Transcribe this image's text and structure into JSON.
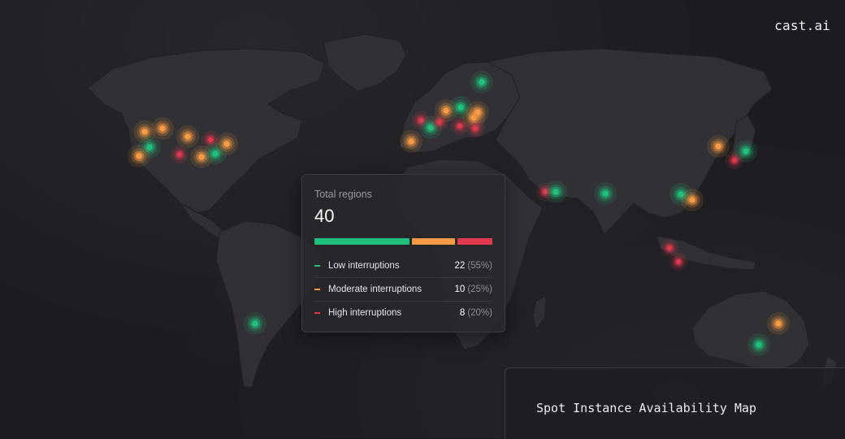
{
  "brand": {
    "logo_text": "cast.ai"
  },
  "summary": {
    "label": "Total regions",
    "total": "40",
    "bar": [
      {
        "key": "low",
        "fraction": 0.55,
        "color": "#1fbf7d"
      },
      {
        "key": "moderate",
        "fraction": 0.25,
        "color": "#f79a45"
      },
      {
        "key": "high",
        "fraction": 0.2,
        "color": "#e0384f"
      }
    ],
    "rows": [
      {
        "name": "Low interruptions",
        "count": "22",
        "percent": "(55%)",
        "color": "#1fbf7d"
      },
      {
        "name": "Moderate interruptions",
        "count": "10",
        "percent": "(25%)",
        "color": "#f79a45"
      },
      {
        "name": "High interruptions",
        "count": "8",
        "percent": "(20%)",
        "color": "#e0384f"
      }
    ]
  },
  "caption": {
    "title": "Spot Instance Availability Map"
  },
  "colors": {
    "low": "#1fbf7d",
    "moderate": "#f79a45",
    "high": "#e0384f",
    "land": "#313134",
    "background": "#1c1c1e"
  },
  "map": {
    "region_markers": [
      {
        "region": "us-west-1",
        "level": "moderate"
      },
      {
        "region": "us-west-2",
        "level": "moderate"
      },
      {
        "region": "us-west-3",
        "level": "low"
      },
      {
        "region": "us-west-4",
        "level": "moderate"
      },
      {
        "region": "us-central-1",
        "level": "moderate"
      },
      {
        "region": "us-central-2",
        "level": "high"
      },
      {
        "region": "us-central-3",
        "level": "moderate"
      },
      {
        "region": "us-east-1",
        "level": "high"
      },
      {
        "region": "us-east-2",
        "level": "low"
      },
      {
        "region": "us-east-3",
        "level": "moderate"
      },
      {
        "region": "sa-east-1",
        "level": "low"
      },
      {
        "region": "eu-north-1",
        "level": "low"
      },
      {
        "region": "eu-west-1",
        "level": "moderate"
      },
      {
        "region": "eu-west-2",
        "level": "high"
      },
      {
        "region": "eu-west-3",
        "level": "low"
      },
      {
        "region": "eu-central-1",
        "level": "high"
      },
      {
        "region": "eu-central-2",
        "level": "moderate"
      },
      {
        "region": "eu-central-3",
        "level": "low"
      },
      {
        "region": "eu-central-4",
        "level": "high"
      },
      {
        "region": "eu-south-1",
        "level": "moderate"
      },
      {
        "region": "eu-south-2",
        "level": "high"
      },
      {
        "region": "eu-south-3",
        "level": "moderate"
      },
      {
        "region": "me-south-1",
        "level": "high"
      },
      {
        "region": "me-central-1",
        "level": "low"
      },
      {
        "region": "ap-south-1",
        "level": "low"
      },
      {
        "region": "ap-southeast-1",
        "level": "low"
      },
      {
        "region": "ap-east-1",
        "level": "moderate"
      },
      {
        "region": "ap-southeast-2",
        "level": "high"
      },
      {
        "region": "ap-southeast-3",
        "level": "high"
      },
      {
        "region": "ap-northeast-1",
        "level": "moderate"
      },
      {
        "region": "ap-northeast-2",
        "level": "high"
      },
      {
        "region": "ap-northeast-3",
        "level": "low"
      },
      {
        "region": "au-east-1",
        "level": "moderate"
      },
      {
        "region": "au-southeast-1",
        "level": "low"
      }
    ]
  }
}
